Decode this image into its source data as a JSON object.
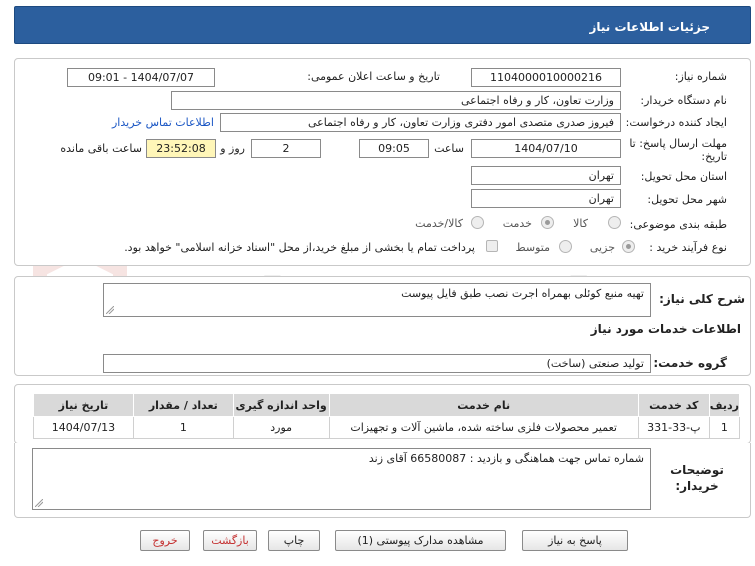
{
  "header": {
    "title": "جزئیات اطلاعات نیاز"
  },
  "form": {
    "need_number_label": "شماره نیاز:",
    "need_number": "1104000010000216",
    "announce_label": "تاریخ و ساعت اعلان عمومی:",
    "announce_value": "1404/07/07 - 09:01",
    "buyer_label": "نام دستگاه خریدار:",
    "buyer_value": "وزارت تعاون، کار و رفاه اجتماعی",
    "creator_label": "ایجاد کننده درخواست:",
    "creator_value": "فیروز صدری متصدی امور دفتری وزارت تعاون، کار و رفاه اجتماعی",
    "contact_link": "اطلاعات تماس خریدار",
    "deadline_label": "مهلت ارسال پاسخ: تا تاریخ:",
    "deadline_date": "1404/07/10",
    "time_label": "ساعت",
    "deadline_time": "09:05",
    "days_value": "2",
    "days_label": "روز و",
    "remaining_value": "23:52:08",
    "remaining_label": "ساعت باقی مانده",
    "province_label": "استان محل تحویل:",
    "province_value": "تهران",
    "city_label": "شهر محل تحویل:",
    "city_value": "تهران",
    "category_label": "طبقه بندی موضوعی:",
    "category_options": [
      "کالا",
      "خدمت",
      "کالا/خدمت"
    ],
    "process_label": "نوع فرآیند خرید :",
    "process_options": [
      "جزیی",
      "متوسط"
    ],
    "payment_note": "پرداخت تمام یا بخشی از مبلغ خرید،از محل \"اسناد خزانه اسلامی\" خواهد بود."
  },
  "summary": {
    "label": "شرح کلی نیاز:",
    "value": "تهیه منبع کوئلی بهمراه اجرت نصب طبق فایل پیوست",
    "services_title": "اطلاعات خدمات مورد نیاز",
    "group_label": "گروه خدمت:",
    "group_value": "تولید صنعتی (ساخت)"
  },
  "table": {
    "headers": [
      "ردیف",
      "کد خدمت",
      "نام خدمت",
      "واحد اندازه گیری",
      "تعداد / مقدار",
      "تاریخ نیاز"
    ],
    "rows": [
      [
        "1",
        "پ-33-331",
        "تعمیر محصولات فلزی ساخته شده، ماشین آلات و تجهیزات",
        "مورد",
        "1",
        "1404/07/13"
      ]
    ]
  },
  "notes": {
    "label": "توضیحات خریدار:",
    "value": "شماره تماس جهت هماهنگی و بازدید : 66580087 آقای زند"
  },
  "buttons": {
    "reply": "پاسخ به نیاز",
    "docs": "مشاهده مدارک پیوستی (1)",
    "print": "چاپ",
    "back": "بازگشت",
    "exit": "خروج"
  },
  "watermark": {
    "brand": "AriaTender.net"
  },
  "colors": {
    "header_bg": "#2c5f9e",
    "remaining_bg": "#fff6b8",
    "link": "#1a56c4",
    "exit_text": "#c43030"
  }
}
